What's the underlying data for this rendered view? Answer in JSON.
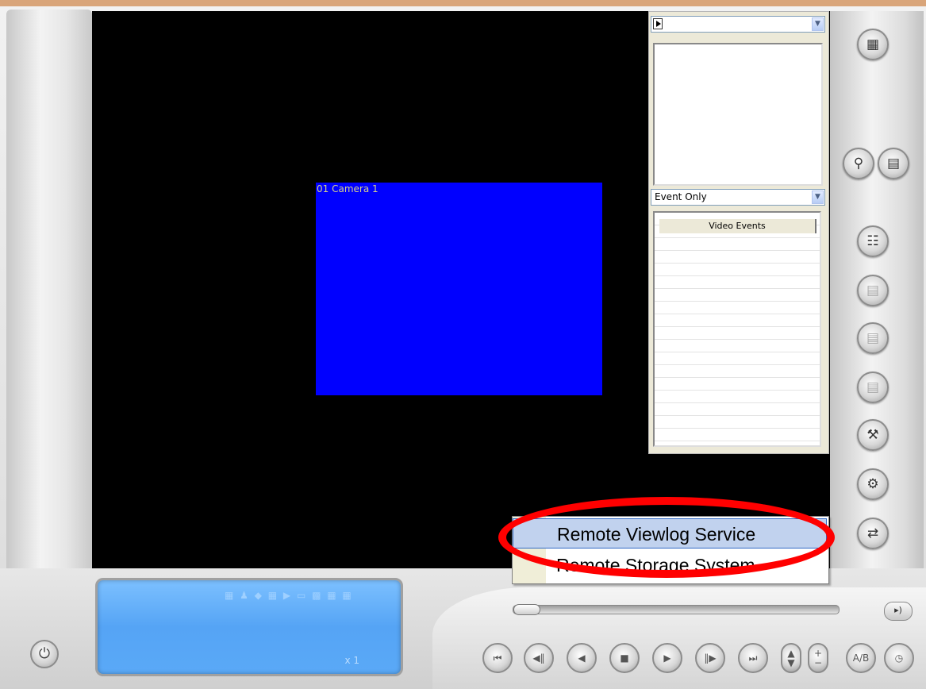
{
  "camera": {
    "label": "01 Camera 1"
  },
  "event_panel": {
    "top_combo_value": "",
    "filter_combo_value": "Event Only",
    "events_column_header": "Video Events"
  },
  "context_menu": {
    "items": [
      {
        "label": "Remote Viewlog Service",
        "highlighted": true
      },
      {
        "label": "Remote Storage System",
        "highlighted": false
      }
    ]
  },
  "status_bar": {
    "speed_label": "x 1"
  },
  "right_toolbar_icons": [
    "layout-icon",
    "search-icon",
    "log-icon",
    "equalizer-icon",
    "save-rw-icon",
    "save-icon",
    "print-icon",
    "tools-icon",
    "settings-icon",
    "network-icon"
  ],
  "playback_icons": [
    "skip-start-icon",
    "step-back-icon",
    "rewind-icon",
    "stop-icon",
    "play-icon",
    "step-forward-icon",
    "skip-end-icon",
    "speed-updown-icon",
    "zoom-plusminus-icon",
    "ab-repeat-icon",
    "clock-icon"
  ],
  "accent_color": "#0000ff",
  "highlight_color": "#ff0000"
}
